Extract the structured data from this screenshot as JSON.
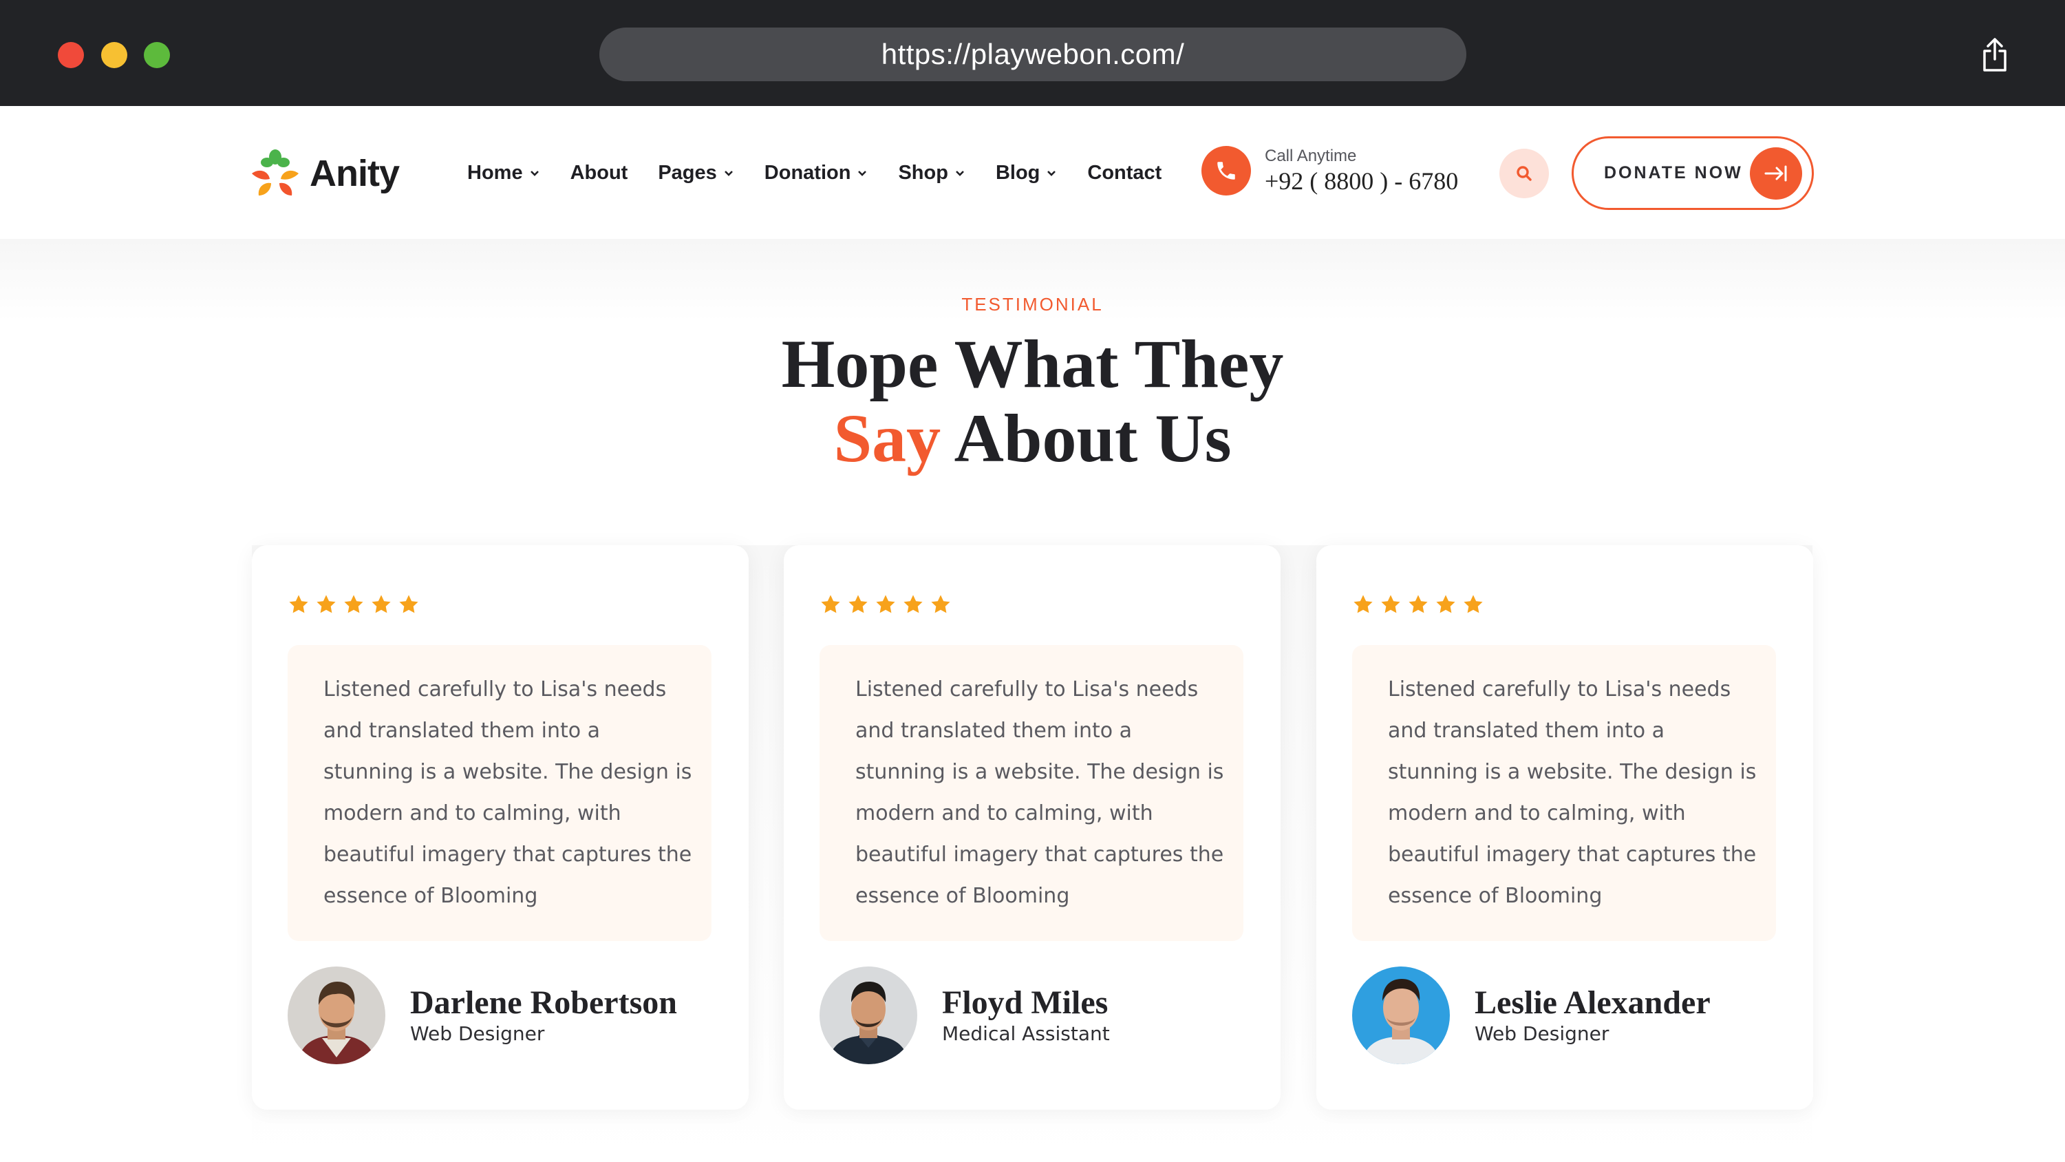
{
  "browser": {
    "url": "https://playwebon.com/"
  },
  "header": {
    "logo_text": "Anity",
    "nav": [
      {
        "label": "Home",
        "has_dropdown": true
      },
      {
        "label": "About",
        "has_dropdown": false
      },
      {
        "label": "Pages",
        "has_dropdown": true
      },
      {
        "label": "Donation",
        "has_dropdown": true
      },
      {
        "label": "Shop",
        "has_dropdown": true
      },
      {
        "label": "Blog",
        "has_dropdown": true
      },
      {
        "label": "Contact",
        "has_dropdown": false
      }
    ],
    "call_label": "Call Anytime",
    "call_number": "+92 ( 8800 ) - 6780",
    "donate_label": "DONATE NOW"
  },
  "testimonial": {
    "eyebrow": "TESTIMONIAL",
    "title_line1": "Hope What They",
    "title_accent": "Say",
    "title_line2_rest": " About Us",
    "cards": [
      {
        "rating": 5,
        "quote": "Listened carefully to Lisa's needs and translated them into a stunning is a website. The design is modern and to calming, with beautiful imagery that captures the essence of Blooming",
        "name": "Darlene Robertson",
        "role": "Web Designer"
      },
      {
        "rating": 5,
        "quote": "Listened carefully to Lisa's needs and translated them into a stunning is a website. The design is modern and to calming, with beautiful imagery that captures the essence of Blooming",
        "name": "Floyd Miles",
        "role": "Medical Assistant"
      },
      {
        "rating": 5,
        "quote": "Listened carefully to Lisa's needs and translated them into a stunning is a website. The design is modern and to calming, with beautiful imagery that captures the essence of Blooming",
        "name": "Leslie Alexander",
        "role": "Web Designer"
      }
    ]
  },
  "colors": {
    "accent": "#f25a2f",
    "star": "#f7a21b",
    "chrome": "#222326",
    "quote_bg": "#fff8f2"
  }
}
